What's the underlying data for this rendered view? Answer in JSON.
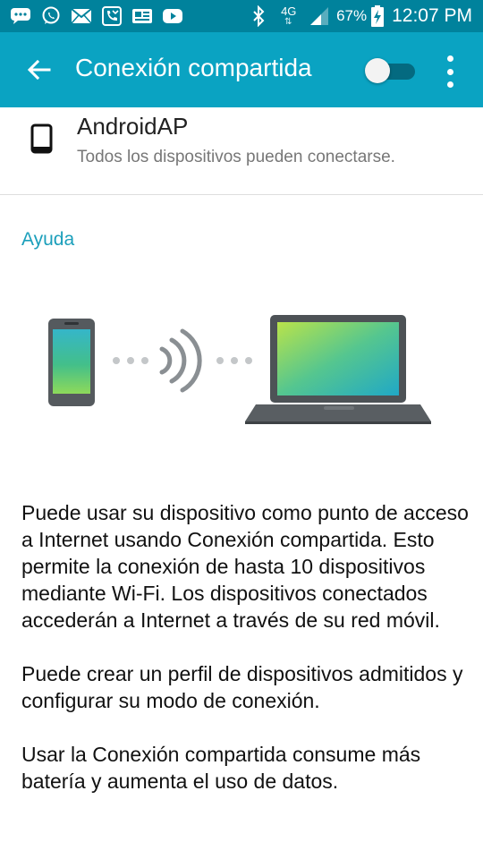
{
  "status_bar": {
    "network_type": "4G",
    "battery_percent": "67%",
    "time": "12:07 PM",
    "left_icons": [
      "messages-icon",
      "whatsapp-icon",
      "mail-icon",
      "missed-call-icon",
      "news-icon",
      "youtube-icon"
    ]
  },
  "app_bar": {
    "title": "Conexión compartida",
    "back_icon": "arrow-left-icon",
    "toggle_state": "off",
    "overflow_icon": "more-vert-icon"
  },
  "network": {
    "name": "AndroidAP",
    "subtitle": "Todos los dispositivos pueden conectarse."
  },
  "help": {
    "title": "Ayuda",
    "paragraphs": [
      "Puede usar su dispositivo como punto de acceso a Internet usando Conexión compartida. Esto permite la conexión de hasta 10 dispositivos mediante Wi-Fi. Los dispositivos conectados accederán a Internet a través de su red móvil.",
      "Puede crear un perfil de dispositivos admitidos y configurar su modo de conexión.",
      "Usar la Conexión compartida consume más batería y aumenta el uso de datos."
    ]
  },
  "colors": {
    "status_bar": "#00829c",
    "app_bar": "#0aa3c2",
    "accent": "#1b9fbb"
  }
}
